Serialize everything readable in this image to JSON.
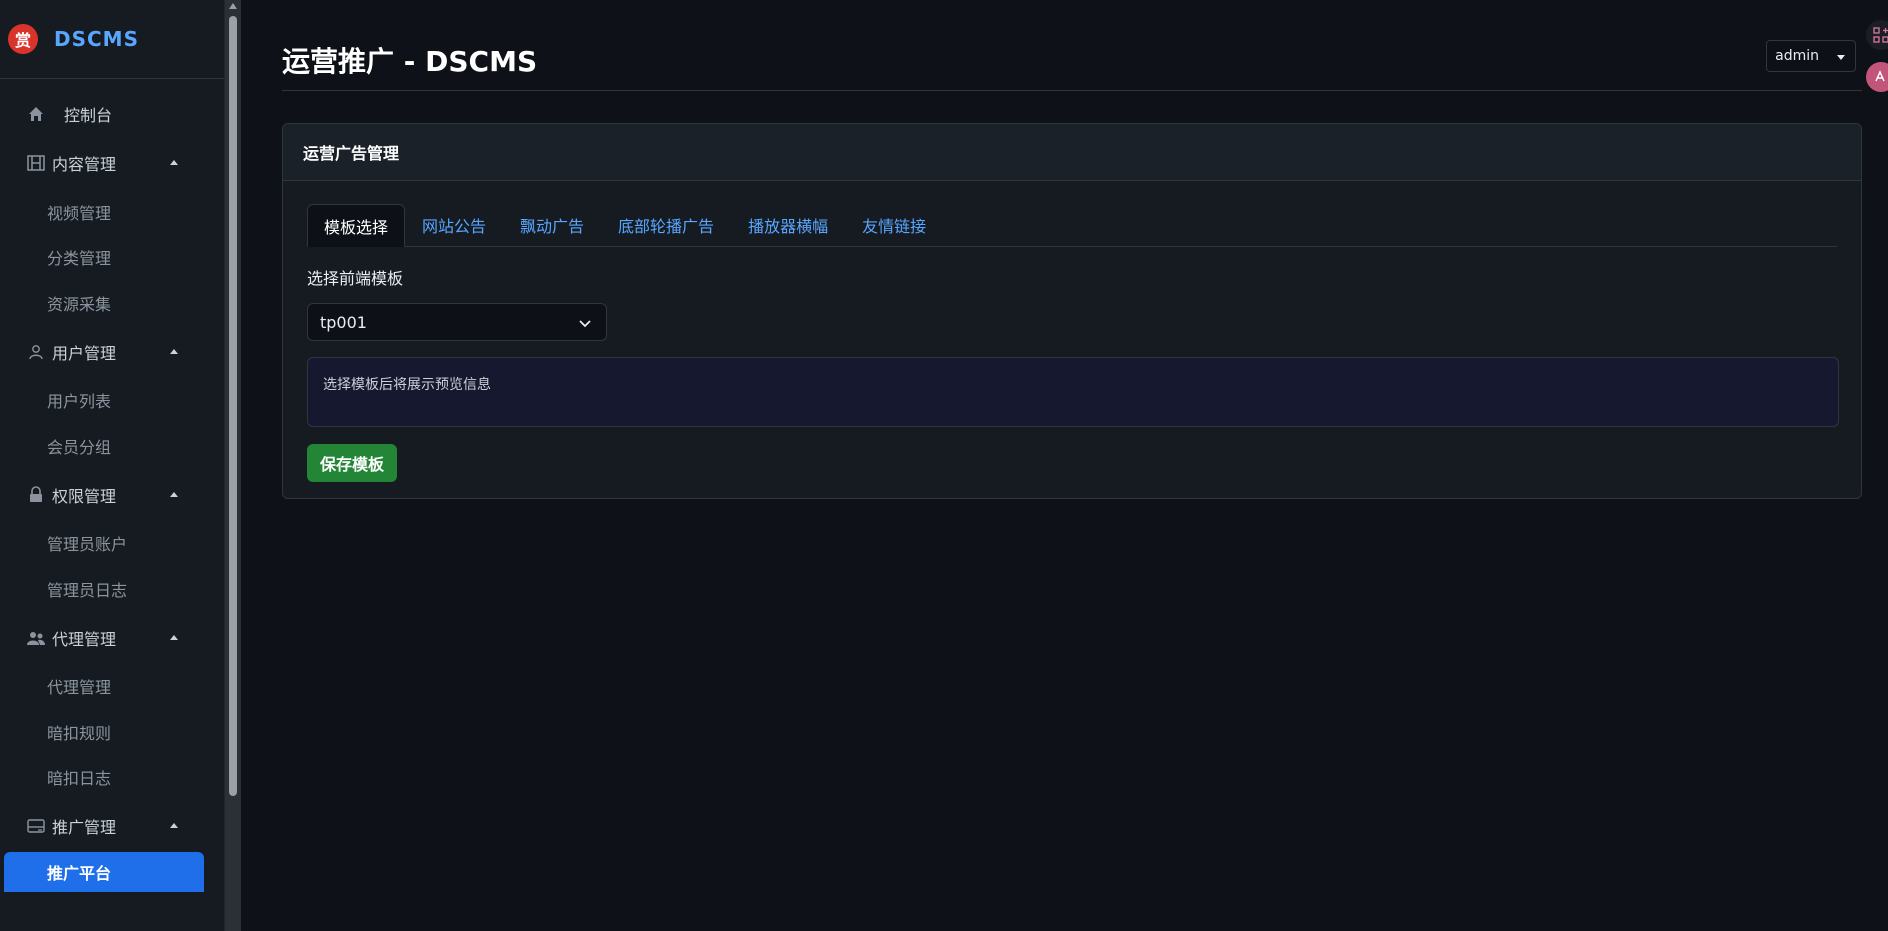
{
  "brand": {
    "logo_char": "赏",
    "name": "DSCMS"
  },
  "sidebar": {
    "dashboard": "控制台",
    "groups": [
      {
        "label": "内容管理",
        "icon": "film-icon",
        "items": [
          "视频管理",
          "分类管理",
          "资源采集"
        ]
      },
      {
        "label": "用户管理",
        "icon": "user-icon",
        "items": [
          "用户列表",
          "会员分组"
        ]
      },
      {
        "label": "权限管理",
        "icon": "lock-icon",
        "items": [
          "管理员账户",
          "管理员日志"
        ]
      },
      {
        "label": "代理管理",
        "icon": "people-icon",
        "items": [
          "代理管理",
          "暗扣规则",
          "暗扣日志"
        ]
      },
      {
        "label": "推广管理",
        "icon": "card-icon",
        "items": [
          "推广平台"
        ]
      }
    ],
    "active_item": "推广平台"
  },
  "header": {
    "title": "运营推广 - DSCMS",
    "user": "admin"
  },
  "card": {
    "title": "运营广告管理",
    "tabs": [
      "模板选择",
      "网站公告",
      "飘动广告",
      "底部轮播广告",
      "播放器横幅",
      "友情链接"
    ],
    "active_tab": "模板选择",
    "field_label": "选择前端模板",
    "select_value": "tp001",
    "preview_text": "选择模板后将展示预览信息",
    "save_label": "保存模板"
  },
  "colors": {
    "accent": "#58a6ff",
    "active_bg": "#1f6feb",
    "save": "#238636"
  }
}
